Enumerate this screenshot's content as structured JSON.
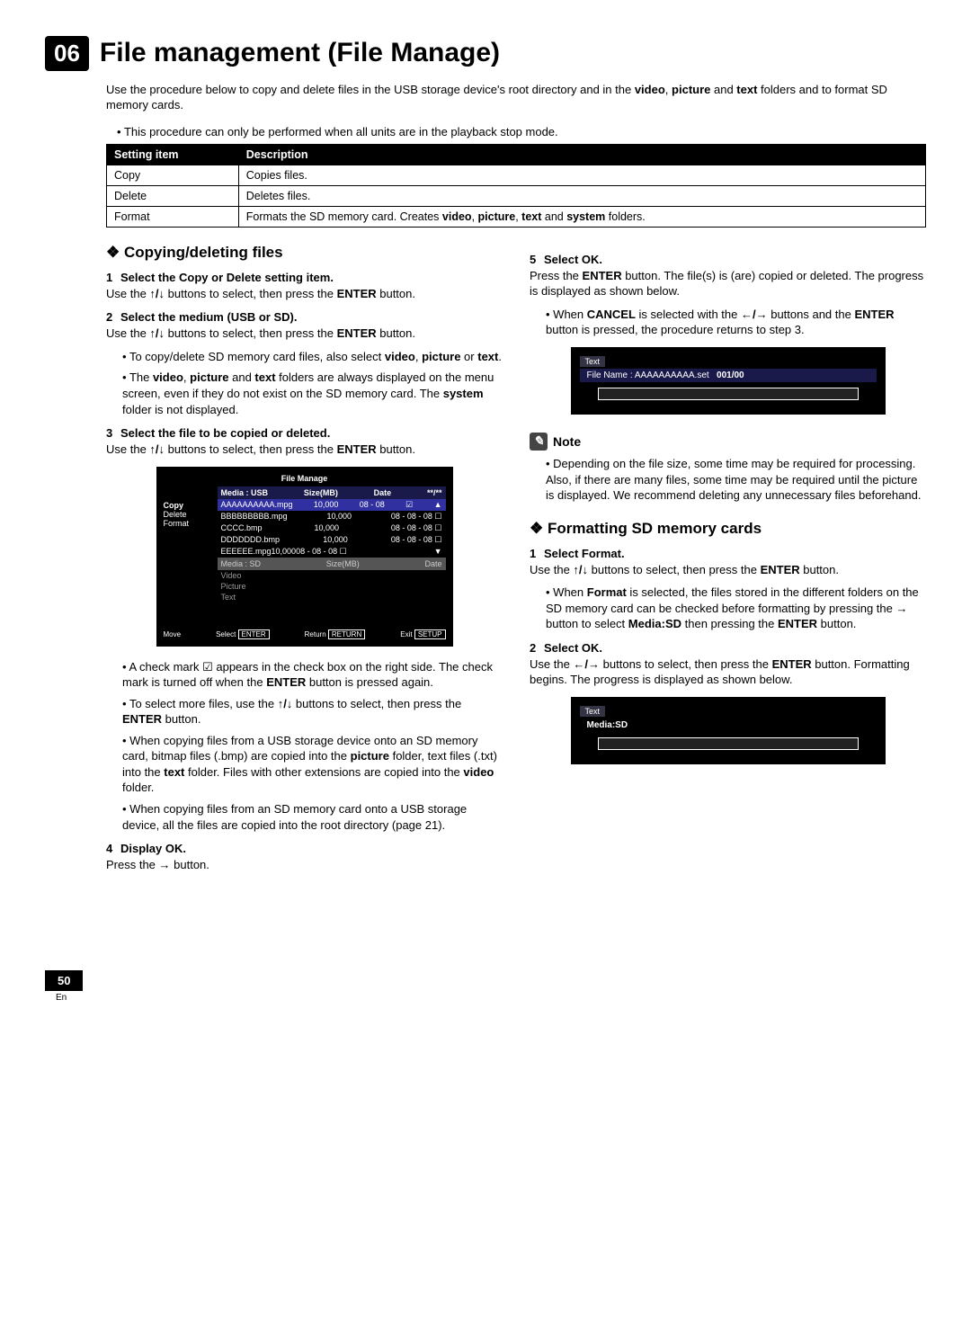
{
  "chapter": {
    "num": "06",
    "title": "File management (File Manage)"
  },
  "intro_pre": "Use the procedure below to copy and delete files in the USB storage device's root directory and in the ",
  "intro_bold1": "video",
  "intro_mid1": ", ",
  "intro_bold2": "picture",
  "intro_mid2": " and ",
  "intro_bold3": "text",
  "intro_post": " folders and to format SD memory cards.",
  "intro_bullet": "This procedure can only be performed when all units are in the playback stop mode.",
  "table": {
    "h1": "Setting item",
    "h2": "Description",
    "r1c1": "Copy",
    "r1c2": "Copies files.",
    "r2c1": "Delete",
    "r2c2": "Deletes files.",
    "r3c1": "Format",
    "r3c2_pre": "Formats the SD memory card. Creates ",
    "r3c2_b1": "video",
    "r3c2_m1": ", ",
    "r3c2_b2": "picture",
    "r3c2_m2": ", ",
    "r3c2_b3": "text",
    "r3c2_m3": " and ",
    "r3c2_b4": "system",
    "r3c2_post": " folders."
  },
  "left": {
    "section": "Copying/deleting files",
    "s1_num": "1",
    "s1_title": "Select the Copy or Delete setting item.",
    "s1_pre": "Use the ",
    "s1_arrows": "↑/↓",
    "s1_mid": " buttons to select, then press the ",
    "s1_enter": "ENTER",
    "s1_post": " button.",
    "s2_num": "2",
    "s2_title": "Select the medium (USB or SD).",
    "s2b1_pre": "To copy/delete SD memory card files, also select ",
    "s2b1_b1": "video",
    "s2b1_m1": ", ",
    "s2b1_b2": "picture",
    "s2b1_m2": " or ",
    "s2b1_b3": "text",
    "s2b1_post": ".",
    "s2b2_pre": "The ",
    "s2b2_b1": "video",
    "s2b2_m1": ", ",
    "s2b2_b2": "picture",
    "s2b2_m2": " and ",
    "s2b2_b3": "text",
    "s2b2_mid": " folders are always displayed on the menu screen, even if they do not exist on the SD memory card. The ",
    "s2b2_b4": "system",
    "s2b2_post": " folder is not displayed.",
    "s3_num": "3",
    "s3_title": "Select the file to be copied or deleted.",
    "ui": {
      "title": "File Manage",
      "media_usb": "Media : USB",
      "size": "Size(MB)",
      "date": "Date",
      "page": "**/**",
      "copy": "Copy",
      "delete": "Delete",
      "format": "Format",
      "f1n": "AAAAAAAAAA.mpg",
      "f1s": "10,000",
      "f1d": "08 - 08",
      "f2n": "BBBBBBBBB.mpg",
      "f2s": "10,000",
      "f2d": "08 - 08 - 08 ☐",
      "f3n": "CCCC.bmp",
      "f3s": "10,000",
      "f3d": "08 - 08 - 08 ☐",
      "f4n": "DDDDDDD.bmp",
      "f4s": "10,000",
      "f4d": "08 - 08 - 08 ☐",
      "f5n": "EEEEEE.mpg",
      "f5s": "10,000",
      "f5d": "08 - 08 - 08 ☐",
      "media_sd": "Media : SD",
      "video": "Video",
      "picture": "Picture",
      "text": "Text",
      "move": "Move",
      "select": "Select",
      "enter": "ENTER",
      "return": "Return",
      "returnbtn": "RETURN",
      "exit": "Exit",
      "setup": "SETUP",
      "tri_up": "▲",
      "tri_down": "▼",
      "check_on": "☑"
    },
    "s3b1_pre": "A check mark ☑ appears in the check box on the right side. The check mark is turned off when the ",
    "s3b1_enter": "ENTER",
    "s3b1_post": " button is pressed again.",
    "s3b2_pre": "To select more files, use the ",
    "s3b2_arrows": "↑/↓",
    "s3b2_mid": " buttons to select, then press the ",
    "s3b2_enter": "ENTER",
    "s3b2_post": " button.",
    "s3b3_pre": "When copying files from a USB storage device onto an SD memory card, bitmap files (.bmp) are copied into the ",
    "s3b3_b1": "picture",
    "s3b3_m1": " folder, text files (.txt) into the ",
    "s3b3_b2": "text",
    "s3b3_m2": " folder. Files with other extensions are copied into the ",
    "s3b3_b3": "video",
    "s3b3_post": " folder.",
    "s3b4": "When copying files from an SD memory card onto a USB storage device, all the files are copied into the root directory (page 21).",
    "s4_num": "4",
    "s4_title": "Display OK.",
    "s4_pre": "Press the ",
    "s4_arrow": "→",
    "s4_post": " button."
  },
  "right": {
    "s5_num": "5",
    "s5_title": "Select OK.",
    "s5_pre": "Press the ",
    "s5_enter": "ENTER",
    "s5_post": " button. The file(s) is (are) copied or deleted. The progress is displayed as shown below.",
    "s5b1_pre": "When ",
    "s5b1_cancel": "CANCEL",
    "s5b1_mid1": " is selected with the ",
    "s5b1_arrows": "←/→",
    "s5b1_mid2": " buttons and the ",
    "s5b1_enter": "ENTER",
    "s5b1_post": " button is pressed, the procedure returns to step 3.",
    "progress1": {
      "label": "Text",
      "filename_pre": "File Name : AAAAAAAAAA.set",
      "counter": "001/00"
    },
    "note_label": "Note",
    "note_text": "Depending on the file size, some time may be required for processing. Also, if there are many files, some time may be required until the picture is displayed. We recommend deleting any unnecessary files beforehand.",
    "fmt_section": "Formatting SD memory cards",
    "f1_num": "1",
    "f1_title": "Select Format.",
    "f1_pre": "Use the ",
    "f1_arrows": "↑/↓",
    "f1_mid": " buttons to select, then press the ",
    "f1_enter": "ENTER",
    "f1_post": " button.",
    "f1b1_pre": "When ",
    "f1b1_b1": "Format",
    "f1b1_mid1": " is selected, the files stored in the different folders on the SD memory card can be checked before formatting by pressing the ",
    "f1b1_arrow": "→",
    "f1b1_mid2": " button to select ",
    "f1b1_b2": "Media:SD",
    "f1b1_mid3": " then pressing the ",
    "f1b1_enter": "ENTER",
    "f1b1_post": " button.",
    "f2_num": "2",
    "f2_title": "Select OK.",
    "f2_pre": "Use the ",
    "f2_arrows": "←/→",
    "f2_mid": " buttons to select, then press the ",
    "f2_enter": "ENTER",
    "f2_post": " button. Formatting begins. The progress is displayed as shown below.",
    "progress2": {
      "label": "Text",
      "media": "Media:SD"
    }
  },
  "page": {
    "num": "50",
    "lang": "En"
  }
}
